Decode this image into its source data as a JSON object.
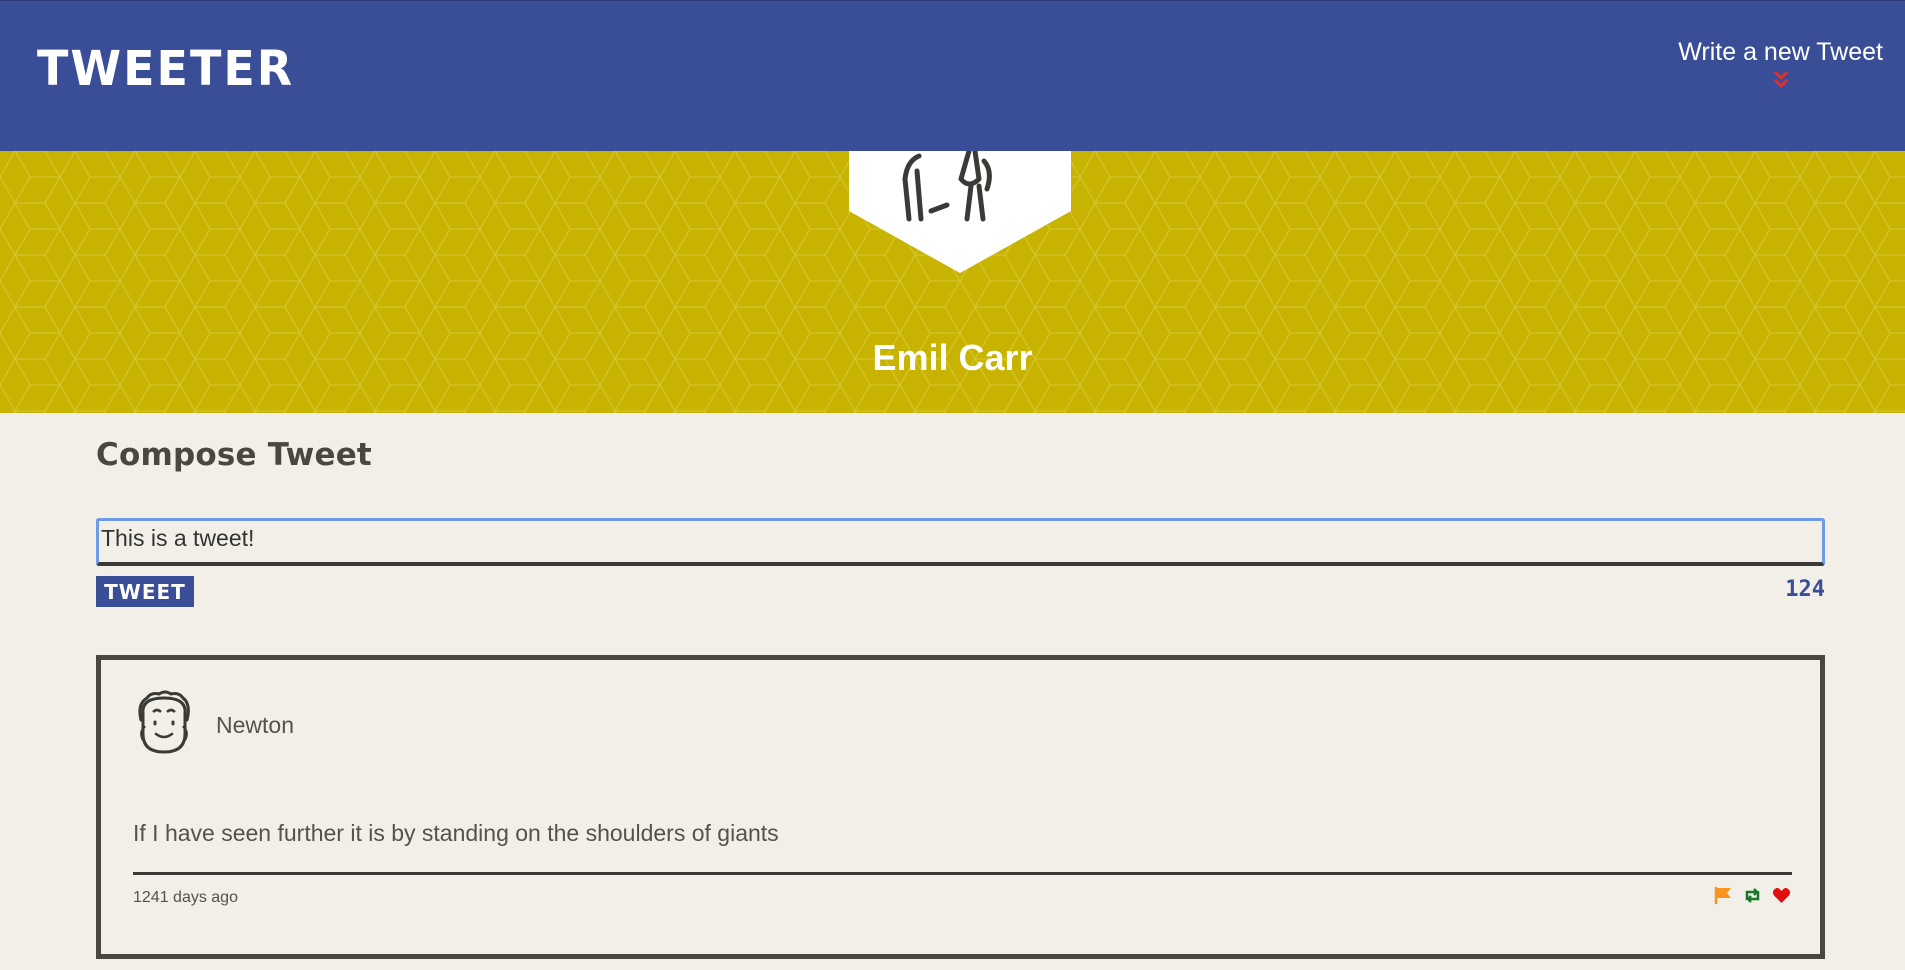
{
  "navbar": {
    "brand": "TWEETER",
    "write_label": "Write a new Tweet",
    "write_icon": "double-chevron-down-icon",
    "bg_color": "#3a4e98"
  },
  "profile": {
    "name": "Emil Carr",
    "avatar_icon": "user-avatar-icon",
    "banner_color": "#c8b400"
  },
  "compose": {
    "title": "Compose Tweet",
    "input_value": "This is a tweet!",
    "submit_label": "TWEET",
    "char_counter": "124"
  },
  "tweets": [
    {
      "author": "Newton",
      "avatar_icon": "newton-avatar-icon",
      "content": "If I have seen further it is by standing on the shoulders of giants",
      "timestamp": "1241 days ago",
      "actions": [
        {
          "icon": "flag-icon",
          "color": "#f7941d"
        },
        {
          "icon": "retweet-icon",
          "color": "#1a7a2a"
        },
        {
          "icon": "heart-icon",
          "color": "#e01010"
        }
      ]
    }
  ]
}
